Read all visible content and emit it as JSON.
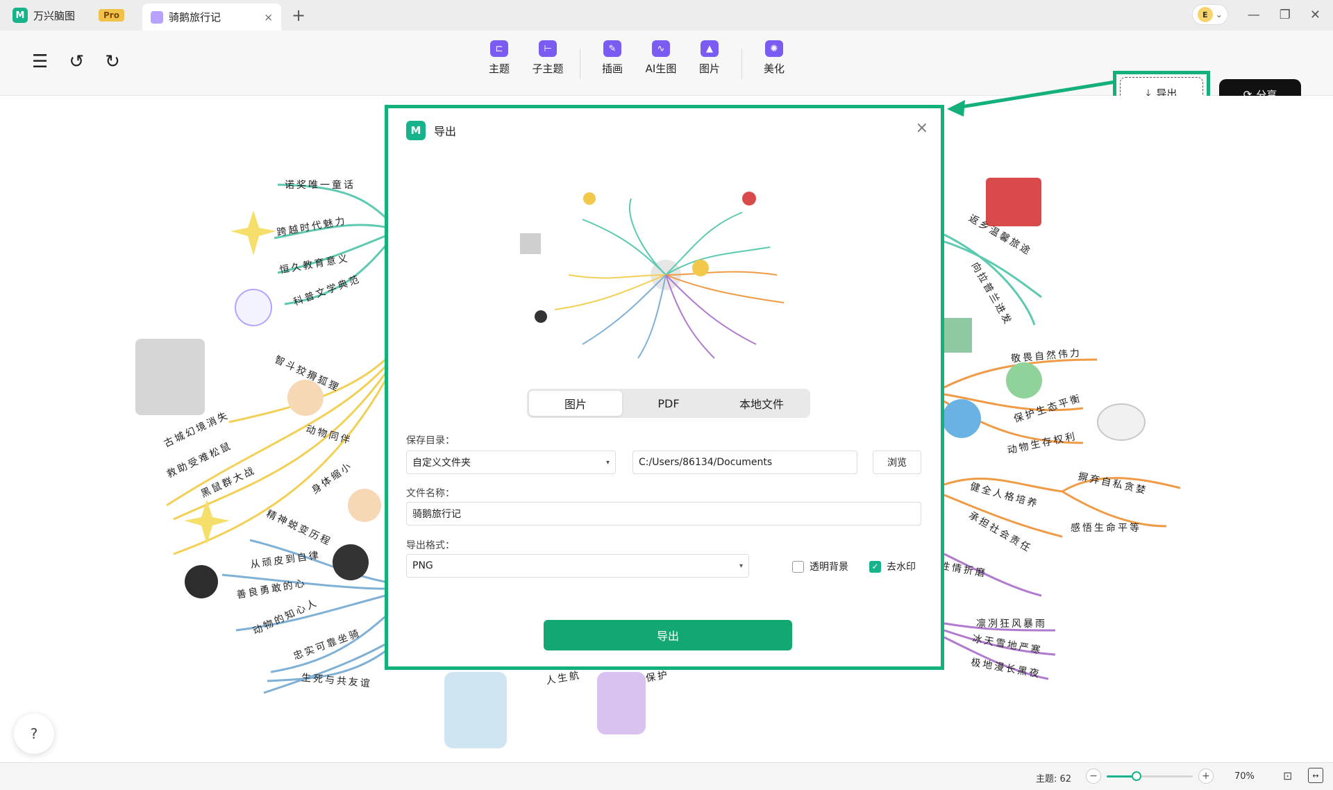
{
  "tabbar": {
    "app_name": "万兴脑图",
    "app_logo": "M",
    "pro_label": "Pro",
    "doc_tab": "骑鹅旅行记",
    "close_glyph": "×",
    "add_glyph": "+",
    "user_initial": "E",
    "user_caret": "⌄",
    "minimize_glyph": "—",
    "restore_glyph": "❐",
    "window_close_glyph": "✕"
  },
  "toolbar": {
    "menu_glyph": "☰",
    "undo_glyph": "↺",
    "redo_glyph": "↻",
    "items": [
      {
        "label": "主题",
        "icon": "topic-icon",
        "glyph": "⊏"
      },
      {
        "label": "子主题",
        "icon": "subtopic-icon",
        "glyph": "⊢"
      },
      {
        "label": "插画",
        "icon": "illustration-icon",
        "glyph": "✎"
      },
      {
        "label": "AI生图",
        "icon": "ai-image-icon",
        "glyph": "∿"
      },
      {
        "label": "图片",
        "icon": "image-icon",
        "glyph": "▲"
      },
      {
        "label": "美化",
        "icon": "beautify-icon",
        "glyph": "✺"
      }
    ],
    "export_label": "导出",
    "export_glyph": "⤓",
    "share_label": "分享",
    "share_glyph": "⟳"
  },
  "mindmap": {
    "labels": [
      "诺奖唯一童话",
      "跨越时代魅力",
      "恒久教育意义",
      "科普文学典范",
      "古城幻境消失",
      "救助受难松鼠",
      "黑鼠群大战",
      "智斗狡猾狐狸",
      "动物同伴",
      "身体缩小",
      "精神蜕变历程",
      "从顽皮到自律",
      "善良勇敢的心",
      "动物的知心人",
      "忠实可靠坐骑",
      "生死与共友谊",
      "人生航",
      "保护",
      "返乡温馨旅途",
      "向拉普兰进发",
      "敬畏自然伟力",
      "保护生态平衡",
      "动物生存权利",
      "健全人格培养",
      "承担社会责任",
      "摒弃自私贪婪",
      "感悟生命平等",
      "性情折磨",
      "凛冽狂风暴雨",
      "冰天雪地严寒",
      "极地漫长黑夜"
    ],
    "colors": {
      "teal": "#5cc9b0",
      "yellow": "#f2cf55",
      "blue": "#7fb0d6",
      "orange": "#ef9a45",
      "purple": "#b07ad0"
    }
  },
  "dialog": {
    "title": "导出",
    "logo": "M",
    "close_glyph": "×",
    "tabs": [
      "图片",
      "PDF",
      "本地文件"
    ],
    "active_tab": "图片",
    "save_dir_label": "保存目录：",
    "save_dir_value": "自定义文件夹",
    "path_value": "C:/Users/86134/Documents",
    "browse_label": "浏览",
    "filename_label": "文件名称：",
    "filename_value": "骑鹅旅行记",
    "format_label": "导出格式：",
    "format_value": "PNG",
    "caret_glyph": "▾",
    "transparent_label": "透明背景",
    "transparent_checked": false,
    "watermark_label": "去水印",
    "watermark_checked": true,
    "check_glyph": "✓",
    "export_button": "导出"
  },
  "statusbar": {
    "topic_count": "主题: 62",
    "zoom_value": "70%",
    "zoom_level": 0.35,
    "minus_glyph": "−",
    "plus_glyph": "+",
    "fit_glyph": "⊡",
    "expand_glyph": "↔"
  },
  "help_glyph": "?",
  "accent_color": "#13b07a"
}
